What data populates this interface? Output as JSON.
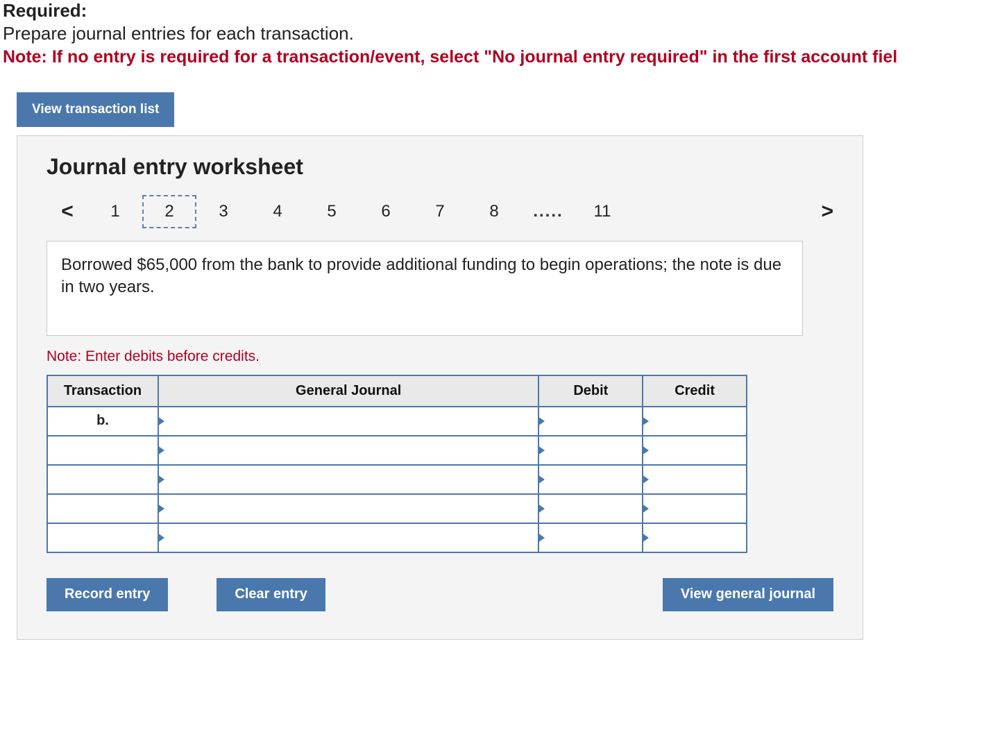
{
  "required": {
    "heading": "Required:",
    "body": "Prepare journal entries for each transaction.",
    "note": "Note: If no entry is required for a transaction/event, select \"No journal entry required\" in the first account fiel"
  },
  "buttons": {
    "view_list": "View transaction list",
    "record": "Record entry",
    "clear": "Clear entry",
    "view_gj": "View general journal"
  },
  "worksheet": {
    "title": "Journal entry worksheet",
    "pager": {
      "prev": "<",
      "next": ">",
      "items": [
        "1",
        "2",
        "3",
        "4",
        "5",
        "6",
        "7",
        "8"
      ],
      "ellipsis": ".....",
      "last": "11",
      "active_index": 1
    },
    "description": "Borrowed $65,000 from the bank to provide additional funding to begin operations; the note is due in two years.",
    "note_line": "Note: Enter debits before credits.",
    "table": {
      "headers": {
        "transaction": "Transaction",
        "general_journal": "General Journal",
        "debit": "Debit",
        "credit": "Credit"
      },
      "rows": [
        {
          "transaction": "b.",
          "gj": "",
          "debit": "",
          "credit": ""
        },
        {
          "transaction": "",
          "gj": "",
          "debit": "",
          "credit": ""
        },
        {
          "transaction": "",
          "gj": "",
          "debit": "",
          "credit": ""
        },
        {
          "transaction": "",
          "gj": "",
          "debit": "",
          "credit": ""
        },
        {
          "transaction": "",
          "gj": "",
          "debit": "",
          "credit": ""
        }
      ]
    }
  }
}
